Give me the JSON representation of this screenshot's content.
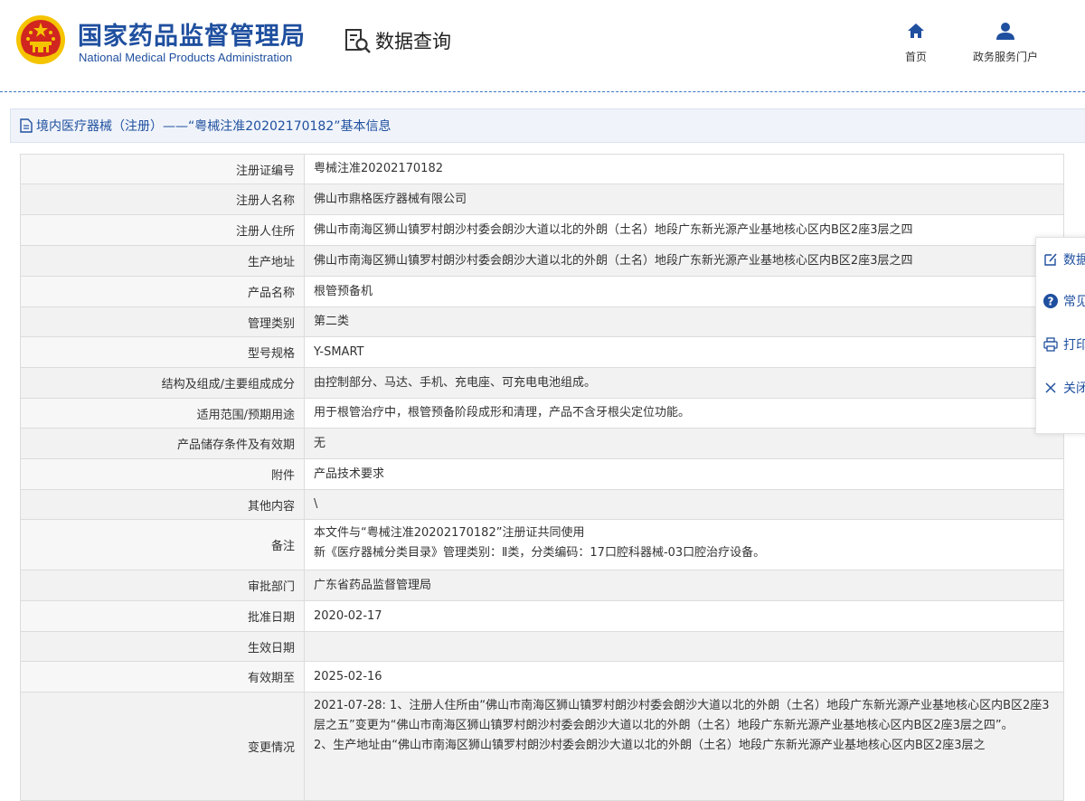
{
  "header": {
    "org_name_cn": "国家药品监督管理局",
    "org_name_en": "National Medical Products Administration",
    "query_label": "数据查询",
    "nav": [
      {
        "label": "首页",
        "icon": "home-icon"
      },
      {
        "label": "政务服务门户",
        "icon": "user-icon"
      }
    ]
  },
  "title": "境内医疗器械（注册）——“粤械注准20202170182”基本信息",
  "rows": [
    {
      "label": "注册证编号",
      "value": "粤械注准20202170182"
    },
    {
      "label": "注册人名称",
      "value": "佛山市鼎格医疗器械有限公司"
    },
    {
      "label": "注册人住所",
      "value": "佛山市南海区狮山镇罗村朗沙村委会朗沙大道以北的外朗（土名）地段广东新光源产业基地核心区内B区2座3层之四"
    },
    {
      "label": "生产地址",
      "value": "佛山市南海区狮山镇罗村朗沙村委会朗沙大道以北的外朗（土名）地段广东新光源产业基地核心区内B区2座3层之四"
    },
    {
      "label": "产品名称",
      "value": "根管预备机"
    },
    {
      "label": "管理类别",
      "value": "第二类"
    },
    {
      "label": "型号规格",
      "value": "Y-SMART"
    },
    {
      "label": "结构及组成/主要组成成分",
      "value": "由控制部分、马达、手机、充电座、可充电电池组成。"
    },
    {
      "label": "适用范围/预期用途",
      "value": "用于根管治疗中，根管预备阶段成形和清理，产品不含牙根尖定位功能。"
    },
    {
      "label": "产品储存条件及有效期",
      "value": "无"
    },
    {
      "label": "附件",
      "value": "产品技术要求"
    },
    {
      "label": "其他内容",
      "value": "\\"
    },
    {
      "label": "备注",
      "value_lines": [
        "本文件与“粤械注准20202170182”注册证共同使用",
        "新《医疗器械分类目录》管理类别：Ⅱ类，分类编码：17口腔科器械-03口腔治疗设备。"
      ]
    },
    {
      "label": "审批部门",
      "value": "广东省药品监督管理局"
    },
    {
      "label": "批准日期",
      "value": "2020-02-17"
    },
    {
      "label": "生效日期",
      "value": ""
    },
    {
      "label": "有效期至",
      "value": "2025-02-16"
    },
    {
      "label": "变更情况",
      "value_lines": [
        "2021-07-28: 1、注册人住所由“佛山市南海区狮山镇罗村朗沙村委会朗沙大道以北的外朗（土名）地段广东新光源产业基地核心区内B区2座3层之五”变更为“佛山市南海区狮山镇罗村朗沙村委会朗沙大道以北的外朗（土名）地段广东新光源产业基地核心区内B区2座3层之四”。",
        "2、生产地址由“佛山市南海区狮山镇罗村朗沙村委会朗沙大道以北的外朗（土名）地段广东新光源产业基地核心区内B区2座3层之"
      ]
    }
  ],
  "side_panel": [
    {
      "label": "数据",
      "icon": "edit-icon"
    },
    {
      "label": "常见",
      "icon": "help-icon"
    },
    {
      "label": "打印",
      "icon": "print-icon"
    },
    {
      "label": "关闭",
      "icon": "close-icon"
    }
  ],
  "colors": {
    "brand": "#1f4f9f",
    "emblem_red": "#d1261f",
    "emblem_gold": "#f5c400"
  }
}
